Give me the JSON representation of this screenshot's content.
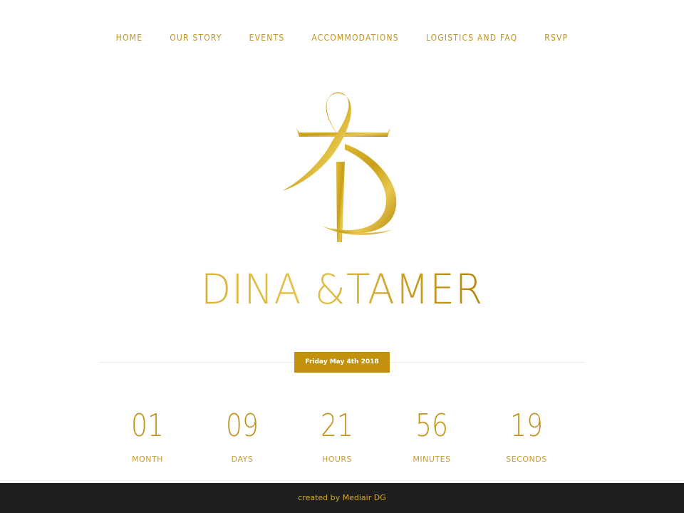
{
  "nav": {
    "items": [
      {
        "label": "HOME"
      },
      {
        "label": "OUR STORY"
      },
      {
        "label": "EVENTS"
      },
      {
        "label": "ACCOMMODATIONS"
      },
      {
        "label": "LOGISTICS AND FAQ"
      },
      {
        "label": "RSVP"
      }
    ]
  },
  "hero": {
    "logo_icon": "dt-monogram-icon",
    "couple_name": "DINA &TAMER",
    "date": "Friday May 4th 2018"
  },
  "countdown": {
    "items": [
      {
        "value": "01",
        "label": "MONTH"
      },
      {
        "value": "09",
        "label": "DAYS"
      },
      {
        "value": "21",
        "label": "HOURS"
      },
      {
        "value": "56",
        "label": "MINUTES"
      },
      {
        "value": "19",
        "label": "SECONDS"
      }
    ]
  },
  "footer": {
    "credit": "created by Mediair DG"
  },
  "colors": {
    "gold": "#c2941f",
    "footer_bg": "#1e1e1e",
    "badge_bg": "#c2920f"
  }
}
